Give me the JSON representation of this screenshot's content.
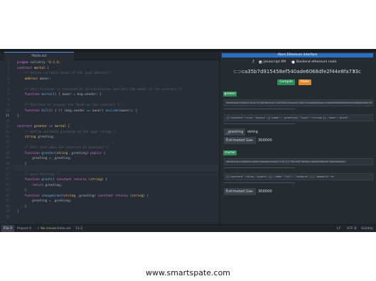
{
  "editor": {
    "tab_title": "Hello.sol",
    "line_numbers": [
      "1",
      "2",
      "3",
      "4",
      "5",
      "6",
      "7",
      "8",
      "9",
      "10",
      "11",
      "12",
      "13",
      "14",
      "15",
      "16",
      "17",
      "18",
      "19",
      "20",
      "21",
      "22",
      "23",
      "24",
      "25",
      "26",
      "27",
      "28",
      "29",
      "30",
      "31"
    ]
  },
  "statusbar": {
    "file": "File 0",
    "project": "Project 0",
    "issues": "✓ No Issues",
    "filename": "Hello.sol",
    "cursor": "11:2",
    "eol": "LF",
    "encoding": "UTF-8",
    "grammar": "Solidity"
  },
  "panel": {
    "title": "Atom Ethereum Interface",
    "radio_js_vm": "Javascript VM",
    "radio_backend": "Backend ethereum node",
    "account": "ca35b7d915458ef540ade6068dfe2f44e8fa733c",
    "compile_label": "Compile",
    "make_label": "Make",
    "compile_color": "#2e8b57",
    "make_color": "#e0892b",
    "contracts": {
      "greeter": {
        "name": "greeter",
        "bytecode": "606060405260405161027038038061027083398101604052805101600080546c01000000000000000000000000003381020404",
        "abi": "[{\"constant\":true,\"inputs\":[{\"name\":\"_greeting\",\"type\":\"string\"}],\"name\":\"greet\"",
        "param_label": "_greeting",
        "param_value": "string",
        "gas_label": "Estimated Gas",
        "gas_value": "300000"
      },
      "mortal": {
        "name": "mortal",
        "bytecode": "606060405260008054600160a060020a0319163317905560738060216000396000f36060604052",
        "abi": "[{\"constant\":false,\"inputs\":[],\"name\":\"kill\",\"outputs\":[],\"payable\":fa",
        "gas_label": "Estimated Gas",
        "gas_value": "300000"
      }
    }
  },
  "footer": "www.smartspate.com"
}
